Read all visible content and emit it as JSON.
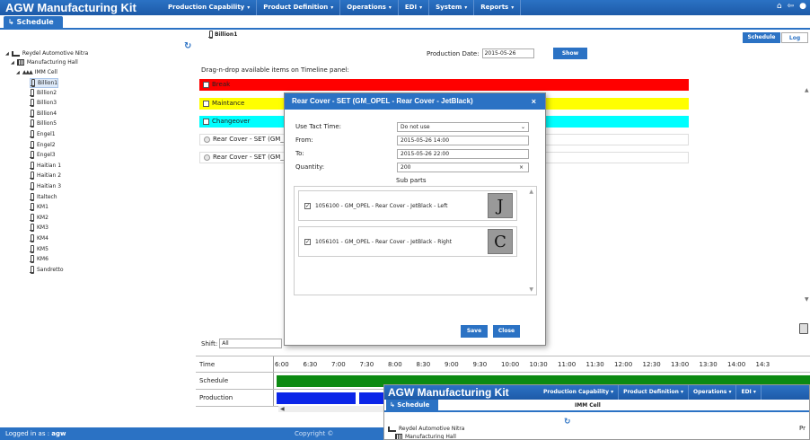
{
  "app": {
    "title": "AGW Manufacturing Kit",
    "schedule_tab": "↳ Schedule"
  },
  "menu": [
    "Production Capability",
    "Product Definition",
    "Operations",
    "EDI",
    "System",
    "Reports"
  ],
  "tree": {
    "company": "Reydel Automotive Nitra",
    "hall": "Manufacturing Hall",
    "cell": "IMM Cell",
    "machines": [
      "Billion1",
      "Billion2",
      "Billion3",
      "Billion4",
      "Billion5",
      "Engel1",
      "Engel2",
      "Engel3",
      "Haitian 1",
      "Haitian 2",
      "Haitian 3",
      "Italtech",
      "KM1",
      "KM2",
      "KM3",
      "KM4",
      "KM5",
      "KM6",
      "Sandretto"
    ],
    "selected": "Billion1"
  },
  "header": {
    "machine": "Billion1",
    "schedule_btn": "Schedule",
    "log_btn": "Log"
  },
  "production_date": {
    "label": "Production Date:",
    "value": "2015-05-26",
    "show_btn": "Show"
  },
  "dnd_label": "Drag-n-drop available items on Timeline panel:",
  "timeline_items": [
    {
      "label": "Break",
      "color": "#ff0000"
    },
    {
      "label": "Maintance",
      "color": "#ffff00"
    },
    {
      "label": "Changeover",
      "color": "#00ffff"
    },
    {
      "label": "Rear Cover - SET (GM_OPEL - Rear Cover - JetBlack)",
      "color": "#ffffff"
    },
    {
      "label": "Rear Cover - SET (GM_OPEL - Rear Cover - JetBlack)",
      "color": "#ffffff"
    }
  ],
  "shift": {
    "label": "Shift:",
    "value": "All"
  },
  "grid": {
    "rows": [
      "Time",
      "Schedule",
      "Production"
    ],
    "times": [
      "6:00",
      "6:30",
      "7:00",
      "7:30",
      "8:00",
      "8:30",
      "9:00",
      "9:30",
      "10:00",
      "10:30",
      "11:00",
      "11:30",
      "12:00",
      "12:30",
      "13:00",
      "13:30",
      "14:00",
      "14:3"
    ]
  },
  "dialog": {
    "title": "Rear Cover - SET (GM_OPEL - Rear Cover - JetBlack)",
    "close": "×",
    "tact_label": "Use Tact Time:",
    "tact_value": "Do not use",
    "from_label": "From:",
    "from_value": "2015-05-26 14:00",
    "to_label": "To:",
    "to_value": "2015-05-26 22:00",
    "qty_label": "Quantity:",
    "qty_value": "200",
    "subparts_label": "Sub parts",
    "subparts": [
      {
        "label": "1056100 - GM_OPEL - Rear Cover - JetBlack - Left",
        "checked": true
      },
      {
        "label": "1056101 - GM_OPEL - Rear Cover - JetBlack - Right",
        "checked": true
      }
    ],
    "save_btn": "Save",
    "close_btn": "Close"
  },
  "footer": {
    "logged_label": "Logged in as :",
    "user": "agw",
    "copyright": "Copyright ©"
  },
  "thumb": {
    "title": "AGW Manufacturing Kit",
    "menu": [
      "Production Capability",
      "Product Definition",
      "Operations",
      "EDI"
    ],
    "schedule_tab": "↳ Schedule",
    "cell": "IMM Cell",
    "company": "Reydel Automotive Nitra",
    "hall": "Manufacturing Hall",
    "pr": "Pr"
  }
}
